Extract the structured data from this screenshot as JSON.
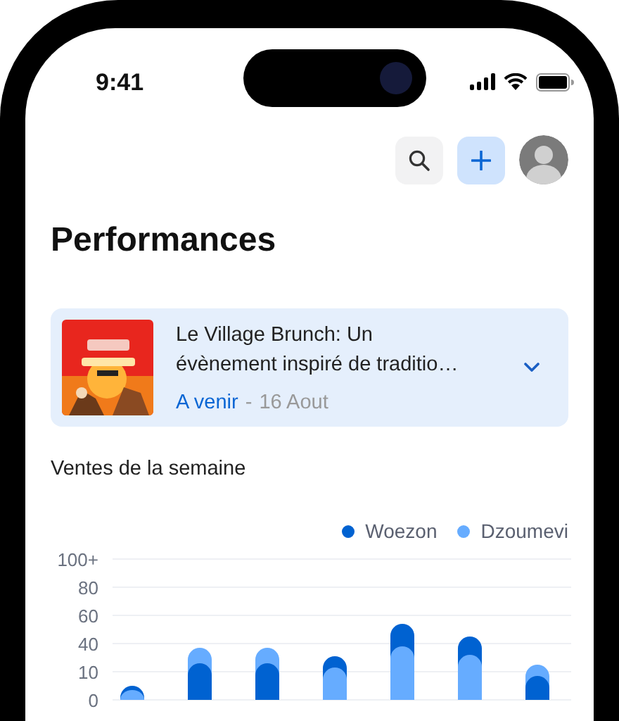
{
  "status_bar": {
    "time": "9:41"
  },
  "page": {
    "title": "Performances"
  },
  "event": {
    "title": "Le Village Brunch: Un évènement inspiré de traditio…",
    "status": "A venir",
    "separator": "-",
    "date": "16 Aout",
    "expanded": false
  },
  "sales": {
    "title": "Ventes de la semaine",
    "legend": [
      {
        "name": "Woezon",
        "color": "#0062d1"
      },
      {
        "name": "Dzoumevi",
        "color": "#66acff"
      }
    ],
    "axis_labels": [
      "100+",
      "80",
      "60",
      "40",
      "10",
      "0"
    ]
  }
}
